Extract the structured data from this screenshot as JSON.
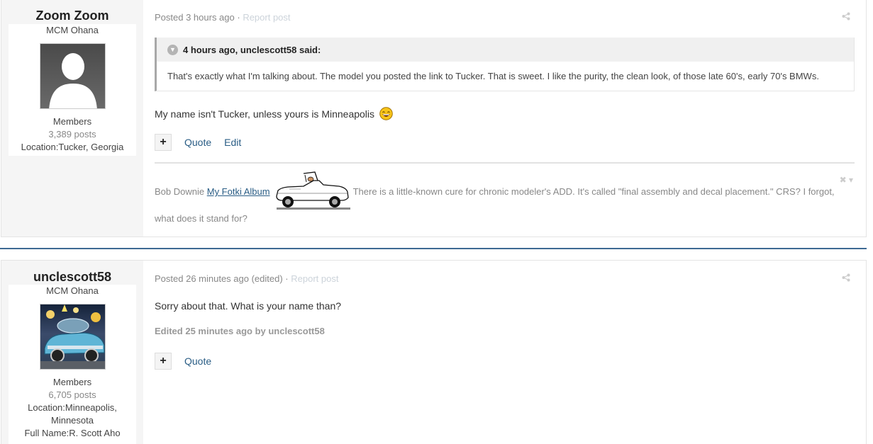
{
  "posts": [
    {
      "author": {
        "name": "Zoom Zoom",
        "group_title": "MCM Ohana",
        "rank": "Members",
        "posts": "3,389 posts",
        "location": "Location:Tucker, Georgia"
      },
      "meta": {
        "posted": "Posted 3 hours ago",
        "separator": " · ",
        "report": "Report post"
      },
      "quote": {
        "header": "4 hours ago, unclescott58 said:",
        "body": "That's exactly what I'm talking about. The model you posted the link to Tucker. That is sweet. I like the purity, the clean look, of those late 60's, early 70's BMWs."
      },
      "body": "My name isn't Tucker, unless yours is Minneapolis",
      "actions": {
        "plus": "+",
        "quote": "Quote",
        "edit": "Edit"
      },
      "signature": {
        "name": "Bob Downie",
        "link": "My Fotki Album",
        "text1": "There is a little-known cure for chronic modeler's ADD. It's called \"final assembly and decal placement.\" CRS? I forgot,",
        "text2": "what does it stand for?"
      }
    },
    {
      "author": {
        "name": "unclescott58",
        "group_title": "MCM Ohana",
        "rank": "Members",
        "posts": "6,705 posts",
        "location_line1": "Location:Minneapolis,",
        "location_line2": "Minnesota",
        "full_name": "Full Name:R. Scott Aho"
      },
      "meta": {
        "posted": "Posted 26 minutes ago (edited)",
        "separator": " · ",
        "report": "Report post"
      },
      "body": "Sorry about that. What is your name than?",
      "edited": "Edited 25 minutes ago by unclescott58",
      "actions": {
        "plus": "+",
        "quote": "Quote"
      }
    }
  ],
  "icons": {
    "share": "share-icon",
    "quote_toggle": "chevron-down-icon",
    "emoji": "grinning-emoji-icon",
    "signature_close": "close-icon"
  },
  "colors": {
    "link": "#2a5d85",
    "separator": "#3e6a93",
    "muted": "#888888"
  }
}
